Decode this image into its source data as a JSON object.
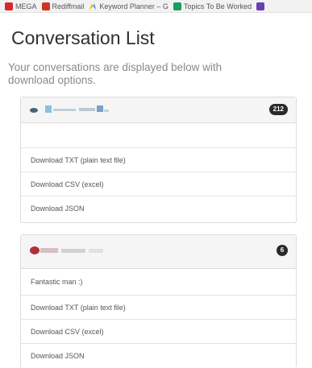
{
  "bookmarks": [
    {
      "label": "MEGA",
      "icon": "mega-icon"
    },
    {
      "label": "Rediffmail",
      "icon": "rediffmail-icon"
    },
    {
      "label": "Keyword Planner – G",
      "icon": "keyword-planner-icon"
    },
    {
      "label": "Topics To Be Worked",
      "icon": "sheets-icon"
    }
  ],
  "page": {
    "title": "Conversation List",
    "subtitle": "Your conversations are displayed below with download options."
  },
  "conversations": [
    {
      "count": "212",
      "message": "",
      "downloads": [
        "Download TXT (plain text file)",
        "Download CSV (excel)",
        "Download JSON"
      ]
    },
    {
      "count": "6",
      "message": "Fantastic man :)",
      "downloads": [
        "Download TXT (plain text file)",
        "Download CSV (excel)",
        "Download JSON"
      ]
    }
  ]
}
